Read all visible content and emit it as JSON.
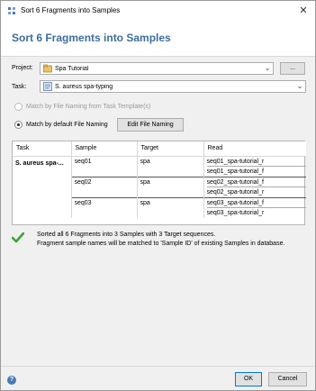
{
  "window": {
    "title": "Sort 6 Fragments into Samples",
    "header_title": "Sort 6 Fragments into Samples"
  },
  "form": {
    "project_label": "Project:",
    "project_value": "Spa Tutorial",
    "browse_label": "...",
    "task_label": "Task:",
    "task_value": "S. aureus spa-typing",
    "radio_template_label": "Match by File Naming from Task Template(s)",
    "radio_default_label": "Match by default File Naming",
    "edit_naming_label": "Edit File Naming"
  },
  "table": {
    "headers": [
      "Task",
      "Sample",
      "Target",
      "Read"
    ],
    "task_name": "S. aureus spa-...",
    "rows": [
      {
        "sample": "seq01",
        "target": "spa",
        "reads": [
          "seq01_spa-tutorial_r",
          "seq01_spa-tutorial_f"
        ]
      },
      {
        "sample": "seq02",
        "target": "spa",
        "reads": [
          "seq02_spa-tutorial_f",
          "seq02_spa-tutorial_r"
        ]
      },
      {
        "sample": "seq03",
        "target": "spa",
        "reads": [
          "seq03_spa-tutorial_f",
          "seq03_spa-tutorial_r"
        ]
      }
    ]
  },
  "status": {
    "line1": "Sorted all 6 Fragments into 3 Samples with 3 Target sequences.",
    "line2": "Fragment sample names will be matched to 'Sample ID' of existing Samples in database."
  },
  "footer": {
    "ok_label": "OK",
    "cancel_label": "Cancel"
  },
  "colors": {
    "header_title": "#3d6d9e",
    "check": "#3aa531"
  }
}
